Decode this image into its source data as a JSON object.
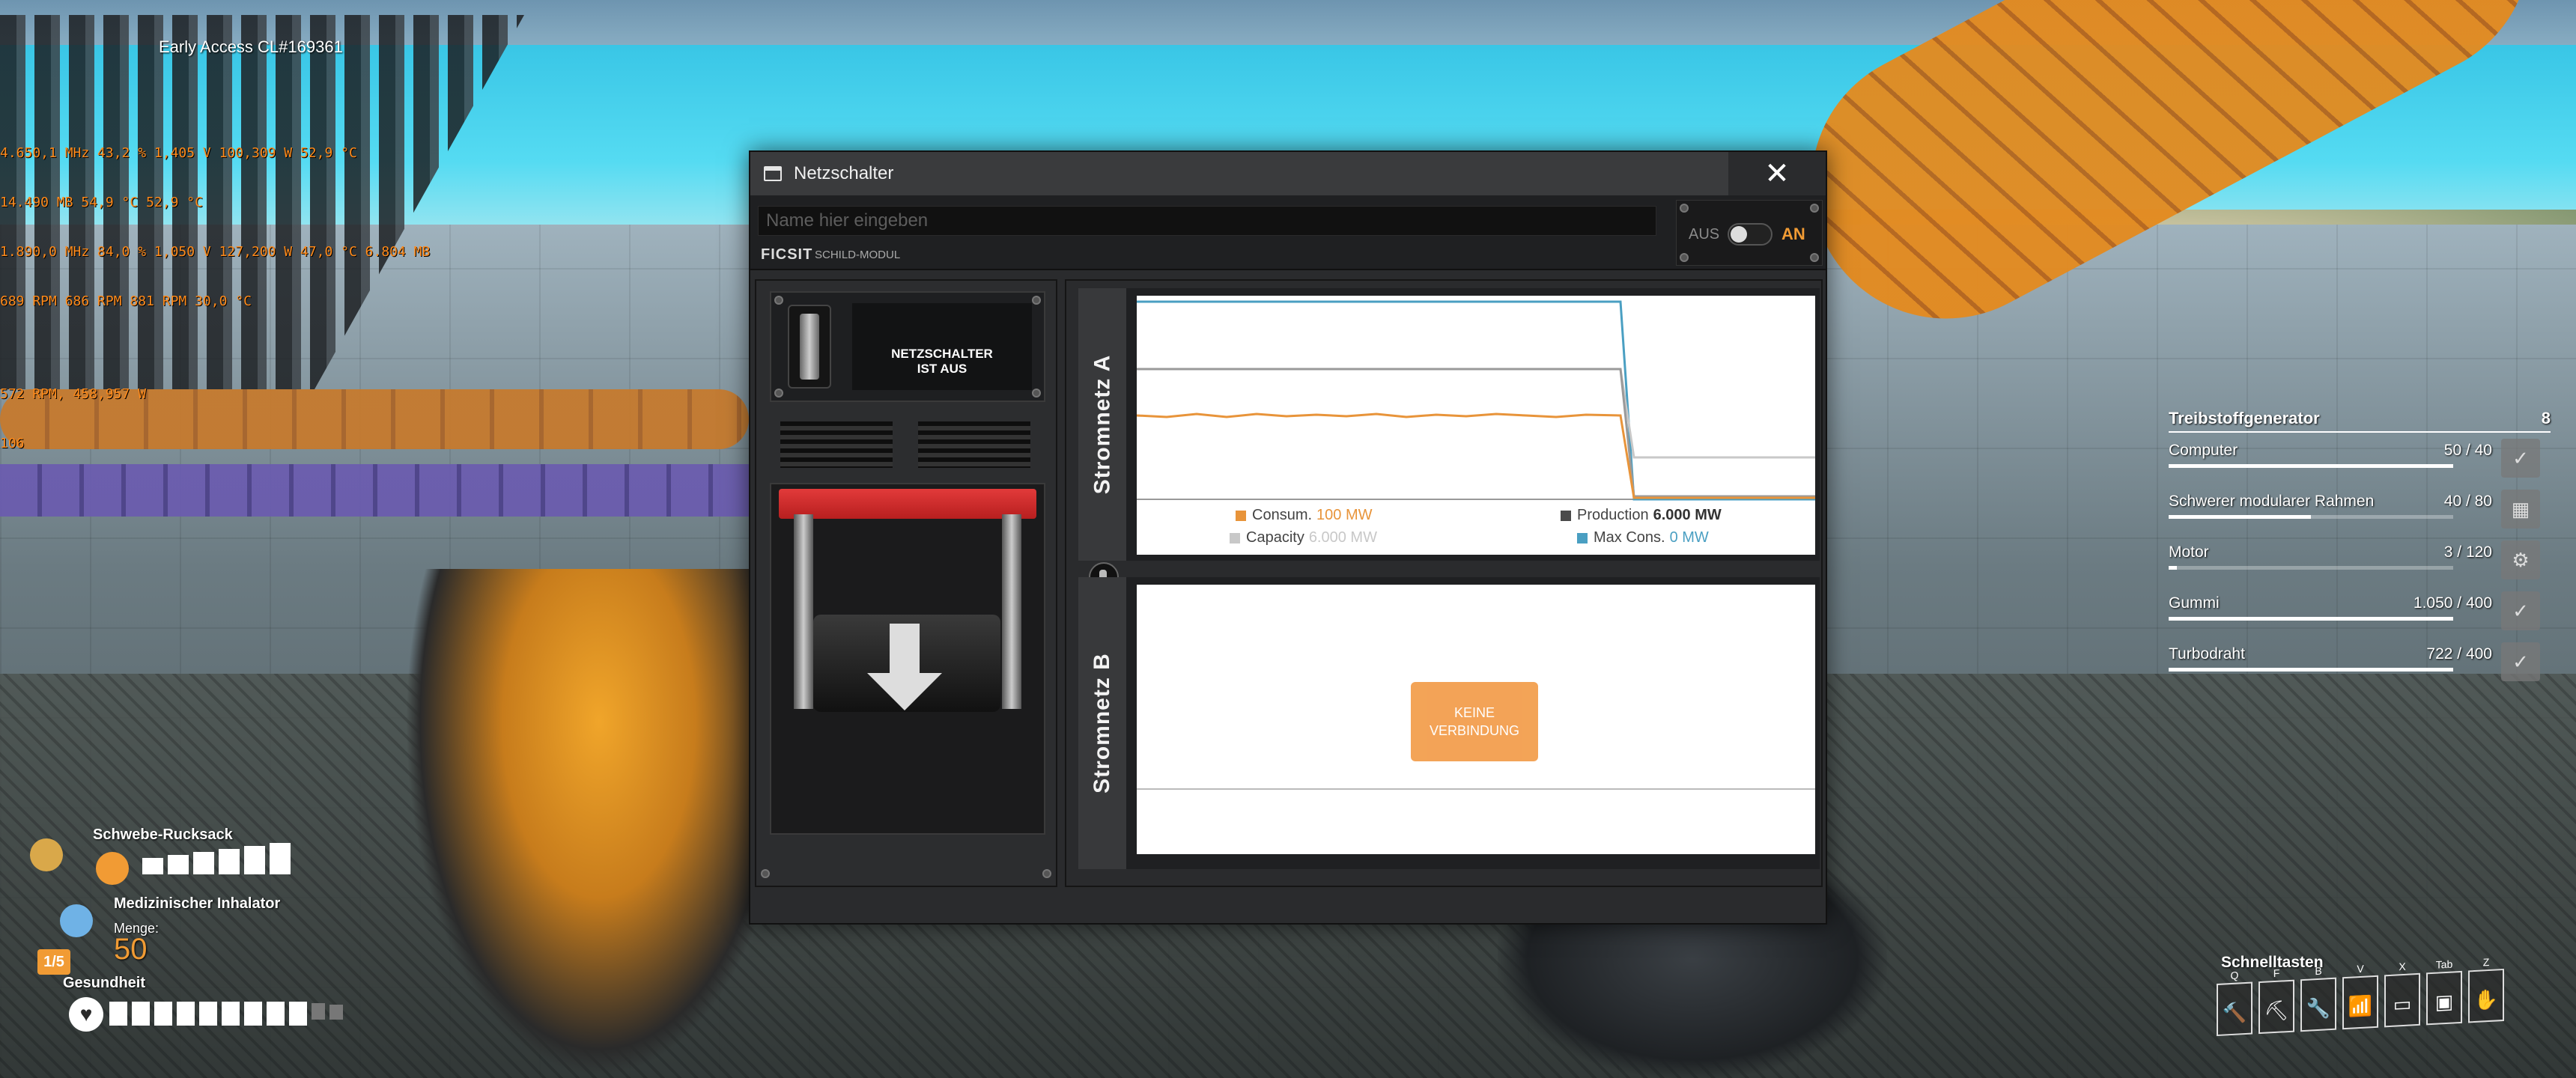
{
  "overlay": {
    "build": "Early Access CL#169361",
    "debug_lines": [
      "4.650,1 MHz 43,2 % 1,405 V 100,309 W 52,9 °C",
      "14.490 MB 54,9 °C 52,9 °C",
      "1.890,0 MHz 84,0 % 1,050 V 127,200 W 47,0 °C 6.804 MB",
      "689 RPM 686 RPM 881 RPM 30,0 °C",
      "",
      "572 RPM, 458,957 W",
      "106"
    ]
  },
  "window": {
    "title": "Netzschalter",
    "close_label": "✕",
    "sign": {
      "name_placeholder": "Name hier eingeben",
      "brand": "FICSIT",
      "brand_sub": "SCHILD-MODUL"
    },
    "toggle": {
      "off_label": "AUS",
      "on_label": "AN"
    },
    "status": {
      "line1": "NETZSCHALTER",
      "line2": "IST AUS"
    },
    "net_a": {
      "label": "Stromnetz A",
      "legend": {
        "consum_label": "Consum.",
        "consum_value": "100 MW",
        "production_label": "Production",
        "production_value": "6.000 MW",
        "capacity_label": "Capacity",
        "capacity_value": "6.000 MW",
        "maxcons_label": "Max Cons.",
        "maxcons_value": "0 MW"
      }
    },
    "net_b": {
      "label": "Stromnetz B",
      "no_connection_line1": "KEINE",
      "no_connection_line2": "VERBINDUNG"
    }
  },
  "colors": {
    "accent": "#f19b34",
    "consumption": "#e8943a",
    "production": "#4a4a4a",
    "capacity": "#c8c8c8",
    "maxcons": "#4a9fc2"
  },
  "production_list": {
    "title": "Treibstoffgenerator",
    "count": "8",
    "items": [
      {
        "name": "Computer",
        "value": "50 / 40",
        "fill": 1.0,
        "icon": "check-icon"
      },
      {
        "name": "Schwerer modularer Rahmen",
        "value": "40 / 80",
        "fill": 0.5,
        "icon": "frame-icon"
      },
      {
        "name": "Motor",
        "value": "3 / 120",
        "fill": 0.025,
        "icon": "motor-icon"
      },
      {
        "name": "Gummi",
        "value": "1.050 / 400",
        "fill": 1.0,
        "icon": "check-icon"
      },
      {
        "name": "Turbodraht",
        "value": "722 / 400",
        "fill": 1.0,
        "icon": "check-icon"
      }
    ]
  },
  "hud": {
    "backpack": "Schwebe-Rucksack",
    "inhaler": "Medizinischer Inhalator",
    "amount_label": "Menge:",
    "amount_value": "50",
    "slot_badge": "1/5",
    "health": "Gesundheit"
  },
  "quickslots": {
    "title": "Schnelltasten",
    "keys": [
      "Q",
      "F",
      "B",
      "V",
      "X",
      "Tab",
      "Z"
    ]
  }
}
